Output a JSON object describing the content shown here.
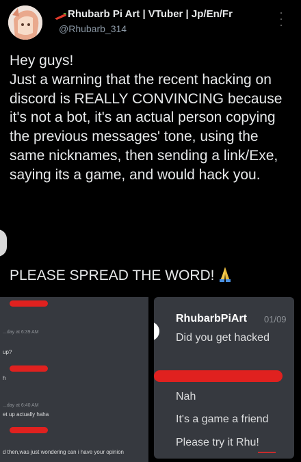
{
  "tweet": {
    "author_name": "Rhubarb Pi Art | VTuber | Jp/En/Fr",
    "handle": "@Rhubarb_314",
    "text": "Hey guys!\nJust a warning that the recent hacking on discord is REALLY CONVINCING because it's not a bot, it's an actual person copying the previous messages' tone, using the same nicknames, then sending a link/Exe, saying its a game, and would hack you.",
    "spread": "PLEASE SPREAD THE WORD!",
    "pray_icon": "folded-hands-icon"
  },
  "left_screenshot": {
    "time1": "...day at 6:39 AM",
    "line1": "up?",
    "line2": "h",
    "time2": "...day at 6:40 AM",
    "line3": "et up actually haha",
    "line4": "d then,was just wondering can i have your opinion"
  },
  "right_screenshot": {
    "username": "RhubarbPiArt",
    "time": "01/09",
    "msg1": "Did you get hacked",
    "msg2": "Nah",
    "msg3": "It's a game a friend",
    "msg4": "Please try it Rhu!"
  },
  "colors": {
    "background": "#000000",
    "text": "#e7e9ea",
    "muted": "#8b98a5",
    "redaction": "#e0211f",
    "discord_bg": "#36393f"
  }
}
